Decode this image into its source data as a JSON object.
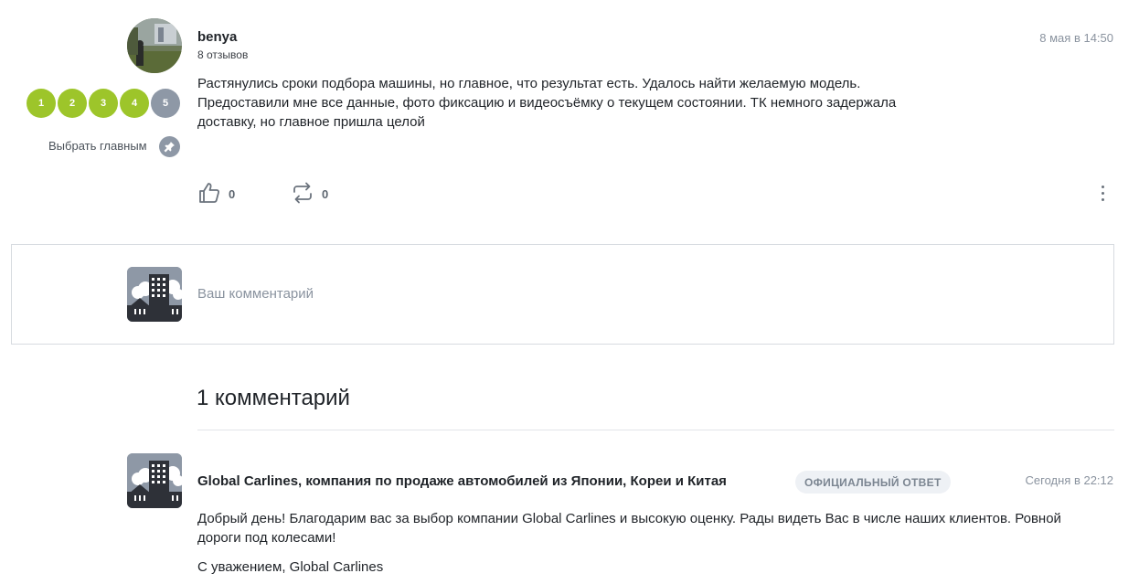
{
  "review": {
    "username": "benya",
    "reviews_count": "8 отзывов",
    "date": "8 мая в 14:50",
    "rating_labels": [
      "1",
      "2",
      "3",
      "4",
      "5"
    ],
    "rating_value": 4,
    "pin_label": "Выбрать главным",
    "text": "Растянулись сроки подбора машины, но главное, что результат есть. Удалось найти желаемую модель. Предоставили мне все данные, фото фиксацию и видеосъёмку о текущем состоянии. ТК немного задержала доставку, но главное пришла целой",
    "likes": "0",
    "shares": "0"
  },
  "comment_input": {
    "placeholder": "Ваш комментарий"
  },
  "comments": {
    "title": "1 комментарий",
    "items": [
      {
        "author": "Global Carlines, компания по продаже автомобилей из Японии, Кореи и Китая",
        "badge": "ОФИЦИАЛЬНЫЙ ОТВЕТ",
        "date": "Сегодня в 22:12",
        "text": "Добрый день! Благодарим вас за выбор компании Global Carlines и высокую оценку. Рады видеть Вас в числе наших клиентов. Ровной дороги под колесами!",
        "signature": "С уважением, Global Carlines"
      }
    ]
  },
  "colors": {
    "rating_active": "#9dc52a",
    "rating_inactive": "#8e98a6",
    "muted_text": "#8a939f"
  },
  "icons": {
    "like": "thumbs-up-icon",
    "share": "repost-icon",
    "more": "vertical-dots-icon",
    "pin": "pin-icon",
    "company": "building-icon"
  }
}
